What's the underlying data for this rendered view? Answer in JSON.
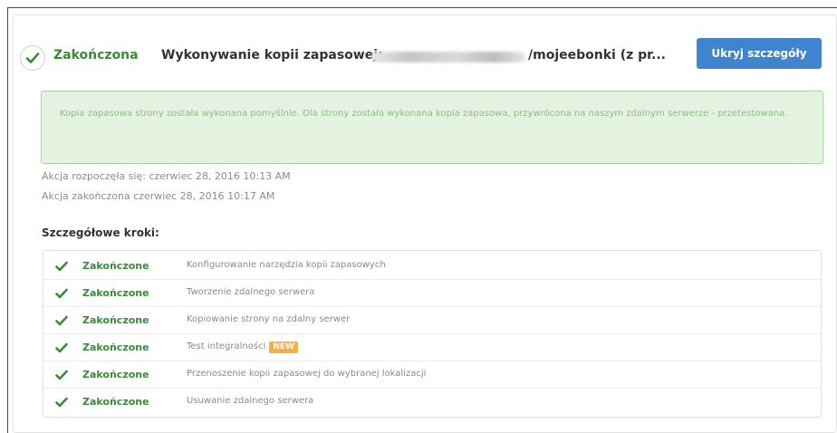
{
  "header": {
    "status": "Zakończona",
    "title_prefix": "Wykonywanie kopii zapasowej:",
    "title_suffix": "/mojeebonki (z pr...",
    "hide_details_label": "Ukryj szczegóły"
  },
  "alert": {
    "message": "Kopia zapasowa strony została wykonana pomyślnie. Dla strony została wykonana kopia zapasowa, przywrócona na naszym zdalnym serwerze - przetestowana."
  },
  "meta": {
    "started": "Akcja rozpoczęła się: czerwiec 28, 2016 10:13 AM",
    "finished": "Akcja zakończona czerwiec 28, 2016 10:17 AM"
  },
  "steps_title": "Szczegółowe kroki:",
  "steps": [
    {
      "status": "Zakończone",
      "description": "Konfigurowanie narzędzia kopii zapasowych",
      "badge": ""
    },
    {
      "status": "Zakończone",
      "description": "Tworzenie zdalnego serwera",
      "badge": ""
    },
    {
      "status": "Zakończone",
      "description": "Kopiowanie strony na zdalny serwer",
      "badge": ""
    },
    {
      "status": "Zakończone",
      "description": "Test integralności",
      "badge": "NEW"
    },
    {
      "status": "Zakończone",
      "description": "Przenoszenie kopii zapasowej do wybranej lokalizacji",
      "badge": ""
    },
    {
      "status": "Zakończone",
      "description": "Usuwanie zdalnego serwera",
      "badge": ""
    }
  ],
  "colors": {
    "success_green": "#3a8a36",
    "button_blue": "#3f84cf",
    "alert_bg": "#e4f3df",
    "badge_orange": "#f5b041"
  },
  "icons": {
    "status": "check-icon",
    "step": "check-icon"
  }
}
